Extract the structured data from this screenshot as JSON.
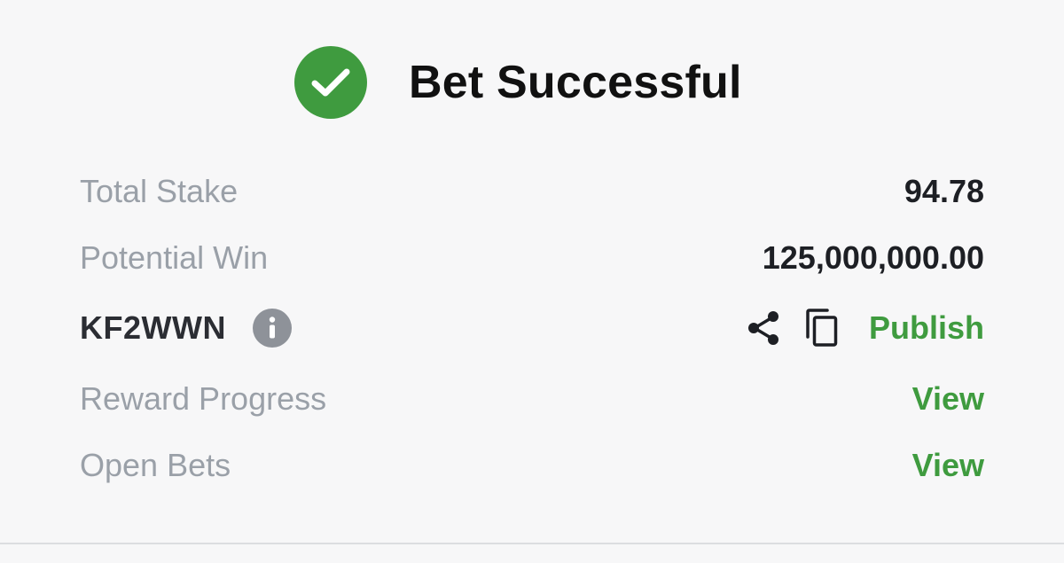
{
  "header": {
    "title": "Bet Successful",
    "icon": "check-circle-icon",
    "accent_color": "#3f9b3f"
  },
  "summary": {
    "total_stake_label": "Total Stake",
    "total_stake_value": "94.78",
    "potential_win_label": "Potential Win",
    "potential_win_value": "125,000,000.00"
  },
  "booking": {
    "code": "KF2WWN",
    "info_icon": "info-icon",
    "share_icon": "share-icon",
    "copy_icon": "copy-icon",
    "publish_label": "Publish"
  },
  "links": {
    "reward_progress_label": "Reward Progress",
    "reward_progress_action": "View",
    "open_bets_label": "Open Bets",
    "open_bets_action": "View"
  }
}
